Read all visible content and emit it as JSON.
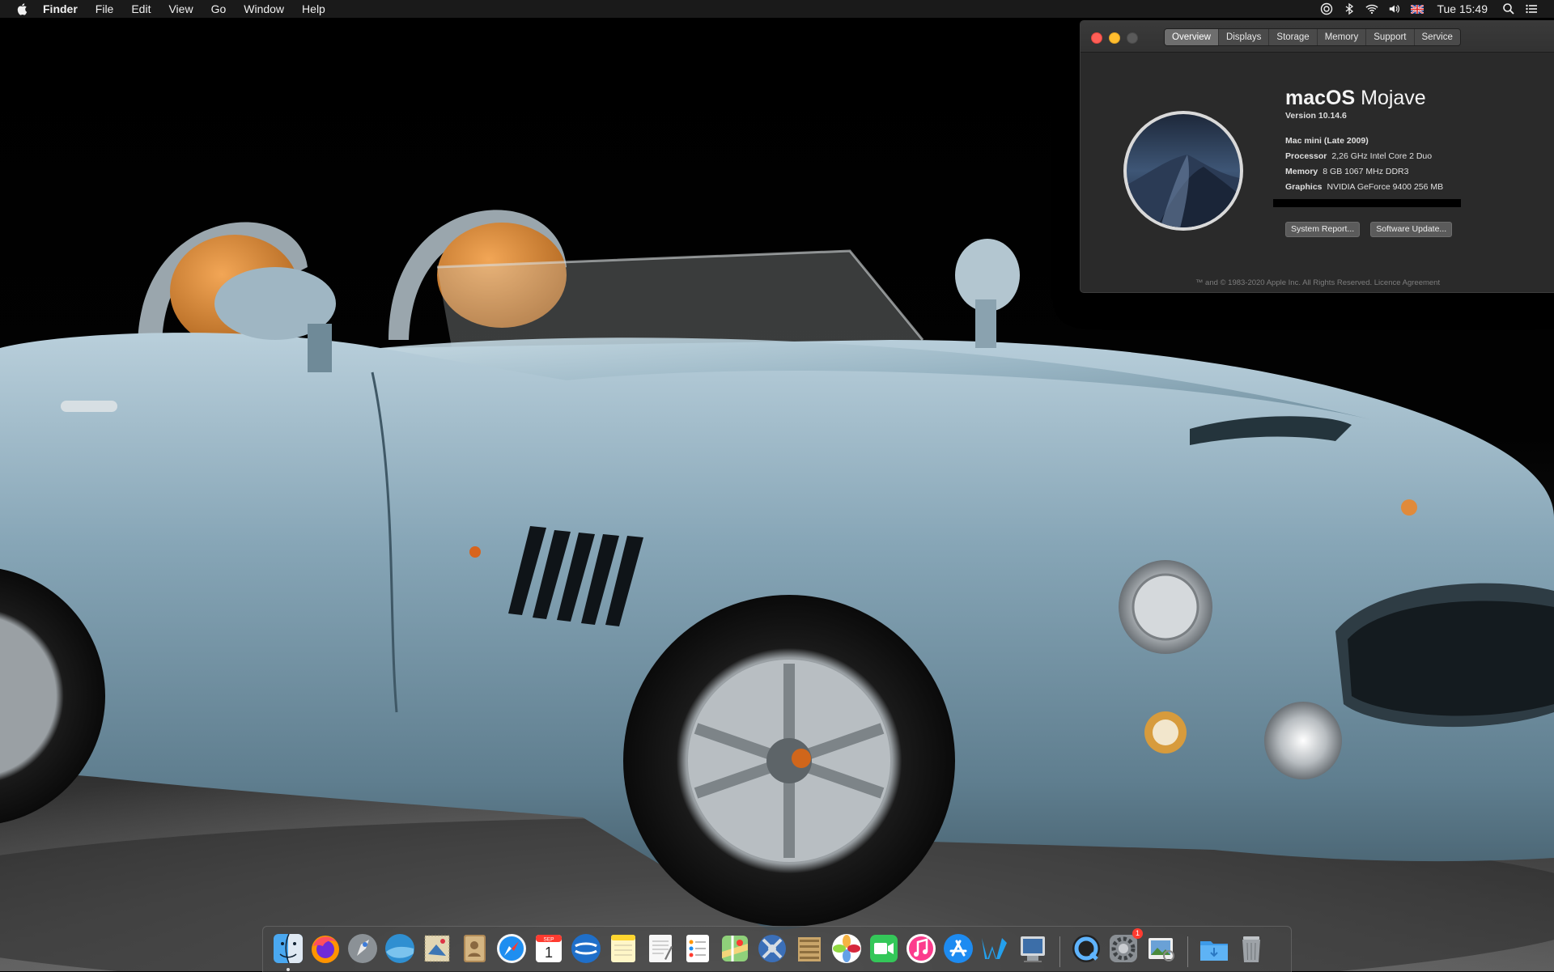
{
  "menubar": {
    "app_name": "Finder",
    "menus": [
      "File",
      "Edit",
      "View",
      "Go",
      "Window",
      "Help"
    ],
    "status_icons": [
      "siri-like-icon",
      "bluetooth-icon",
      "wifi-icon",
      "volume-icon",
      "flag-uk-icon"
    ],
    "clock": "Tue 15:49"
  },
  "about_window": {
    "tabs": [
      "Overview",
      "Displays",
      "Storage",
      "Memory",
      "Support",
      "Service"
    ],
    "active_tab": "Overview",
    "os_name_bold": "macOS",
    "os_name_light": "Mojave",
    "version": "Version 10.14.6",
    "model": "Mac mini (Late 2009)",
    "processor_label": "Processor",
    "processor_value": "2,26 GHz Intel Core 2 Duo",
    "memory_label": "Memory",
    "memory_value": "8 GB 1067 MHz DDR3",
    "graphics_label": "Graphics",
    "graphics_value": "NVIDIA GeForce 9400 256 MB",
    "system_report_button": "System Report...",
    "software_update_button": "Software Update...",
    "footer": "™ and © 1983-2020 Apple Inc. All Rights Reserved. Licence Agreement"
  },
  "dock": {
    "items": [
      {
        "name": "finder",
        "running": true
      },
      {
        "name": "firefox",
        "running": false
      },
      {
        "name": "launchpad",
        "running": false
      },
      {
        "name": "mavericks-like",
        "running": false
      },
      {
        "name": "mail-stamp",
        "running": false
      },
      {
        "name": "contacts",
        "running": false
      },
      {
        "name": "safari",
        "running": false
      },
      {
        "name": "calendar",
        "running": false
      },
      {
        "name": "finder-blue",
        "running": false
      },
      {
        "name": "notes",
        "running": false
      },
      {
        "name": "textedit",
        "running": false
      },
      {
        "name": "reminders",
        "running": false
      },
      {
        "name": "maps",
        "running": false
      },
      {
        "name": "xcode-like",
        "running": false
      },
      {
        "name": "archive",
        "running": false
      },
      {
        "name": "photos",
        "running": false
      },
      {
        "name": "facetime",
        "running": false
      },
      {
        "name": "itunes",
        "running": false
      },
      {
        "name": "app-store",
        "running": false
      },
      {
        "name": "writer",
        "running": false
      },
      {
        "name": "system-info",
        "running": false
      },
      {
        "name": "quicktime",
        "running": false
      },
      {
        "name": "system-preferences",
        "running": false,
        "badge": "1"
      },
      {
        "name": "preview",
        "running": false
      },
      {
        "name": "downloads-folder",
        "running": false
      },
      {
        "name": "trash",
        "running": false
      }
    ],
    "calendar_month": "SEP",
    "calendar_day": "1"
  },
  "colors": {
    "car_body": "#7f9fb0",
    "seat": "#d98a3a",
    "menubar": "#1c1c1c",
    "window_bg": "#2a2a2a"
  }
}
